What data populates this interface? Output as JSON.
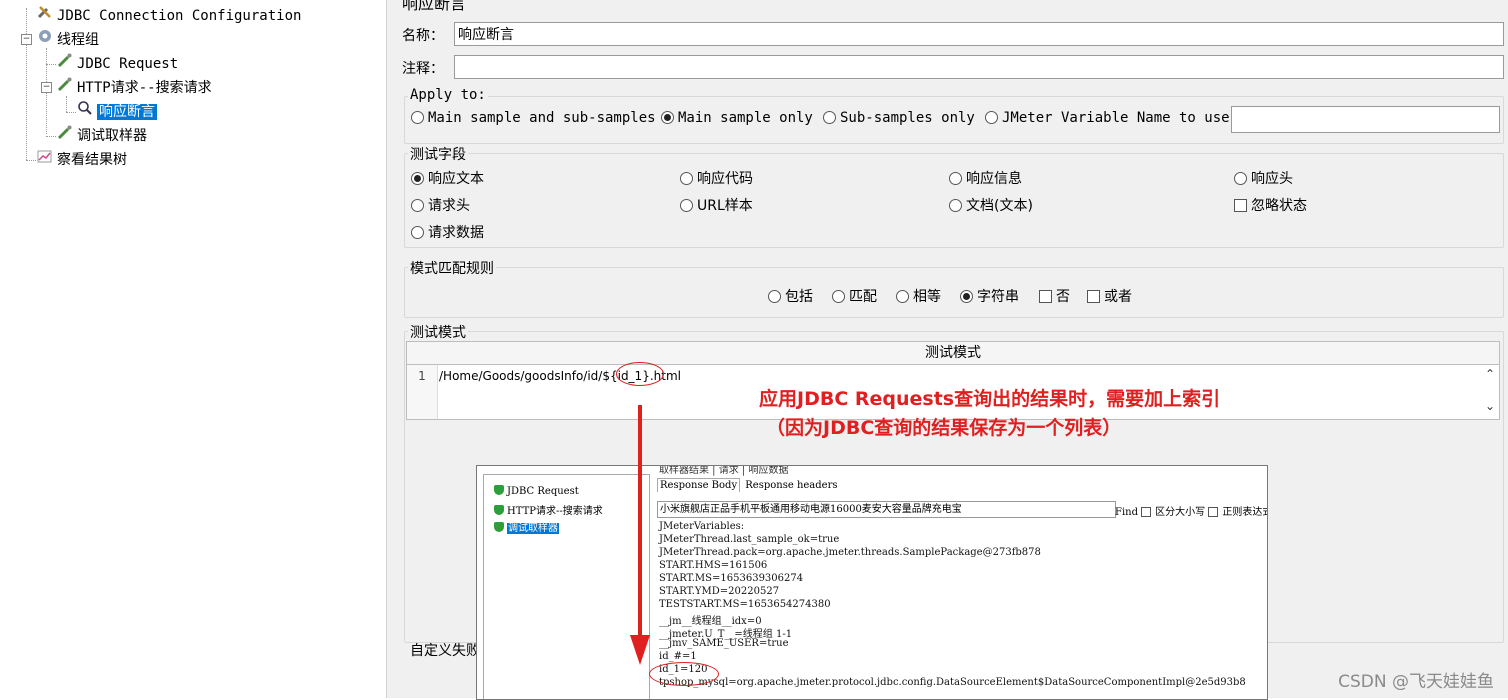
{
  "tree": {
    "items": [
      {
        "label": "JDBC Connection Configuration",
        "icon": "wrench-icon"
      },
      {
        "label": "线程组",
        "icon": "gear-icon"
      },
      {
        "label": "JDBC Request",
        "icon": "pipette-icon"
      },
      {
        "label": "HTTP请求--搜索请求",
        "icon": "pipette-icon"
      },
      {
        "label": "响应断言",
        "icon": "magnifier-icon"
      },
      {
        "label": "调试取样器",
        "icon": "pipette-icon"
      },
      {
        "label": "察看结果树",
        "icon": "chart-icon"
      }
    ]
  },
  "panel": {
    "title": "响应断言",
    "name_label": "名称：",
    "name_value": "响应断言",
    "comment_label": "注释：",
    "comment_value": "",
    "apply_to": {
      "title": "Apply to:",
      "options": [
        "Main sample and sub-samples",
        "Main sample only",
        "Sub-samples only",
        "JMeter Variable Name to use"
      ],
      "selected": "Main sample only",
      "var_value": ""
    },
    "test_field": {
      "title": "测试字段",
      "options": [
        "响应文本",
        "响应代码",
        "响应信息",
        "响应头",
        "请求头",
        "URL样本",
        "文档(文本)",
        "忽略状态",
        "请求数据"
      ],
      "selected": "响应文本"
    },
    "pattern_rules": {
      "title": "模式匹配规则",
      "options": [
        "包括",
        "匹配",
        "相等",
        "字符串",
        "否",
        "或者"
      ],
      "selected": "字符串"
    },
    "test_patterns": {
      "title": "测试模式",
      "column_header": "测试模式",
      "line_number": "1",
      "pattern": "/Home/Goods/goodsInfo/id/${id_1}.html"
    },
    "custom_failure_label": "自定义失败"
  },
  "annotation": {
    "line1": "应用JDBC  Requests查询出的结果时，需要加上索引",
    "line2": "（因为JDBC查询的结果保存为一个列表）",
    "color": "#e02020"
  },
  "inset": {
    "tree_items": [
      "JDBC Request",
      "HTTP请求--搜索请求",
      "调试取样器"
    ],
    "top_tabs": [
      "取样器结果",
      "请求",
      "响应数据"
    ],
    "sub_tabs": [
      "Response Body",
      "Response headers"
    ],
    "search_value": "小米旗舰店正品手机平板通用移动电源16000麦安大容量品牌充电宝",
    "find_label": "Find",
    "case_label": "区分大小写",
    "regex_label": "正则表达式",
    "response_lines": [
      "JMeterVariables:",
      "JMeterThread.last_sample_ok=true",
      "JMeterThread.pack=org.apache.jmeter.threads.SamplePackage@273fb878",
      "START.HMS=161506",
      "START.MS=1653639306274",
      "START.YMD=20220527",
      "TESTSTART.MS=1653654274380",
      "__jm__线程组__idx=0",
      "__jmeter.U_T__=线程组 1-1",
      "__jmv_SAME_USER=true",
      "id_#=1",
      "id_1=120",
      "tpshop_mysql=org.apache.jmeter.protocol.jdbc.config.DataSourceElement$DataSourceComponentImpl@2e5d93b8"
    ]
  },
  "watermark": "CSDN @飞天娃娃鱼"
}
